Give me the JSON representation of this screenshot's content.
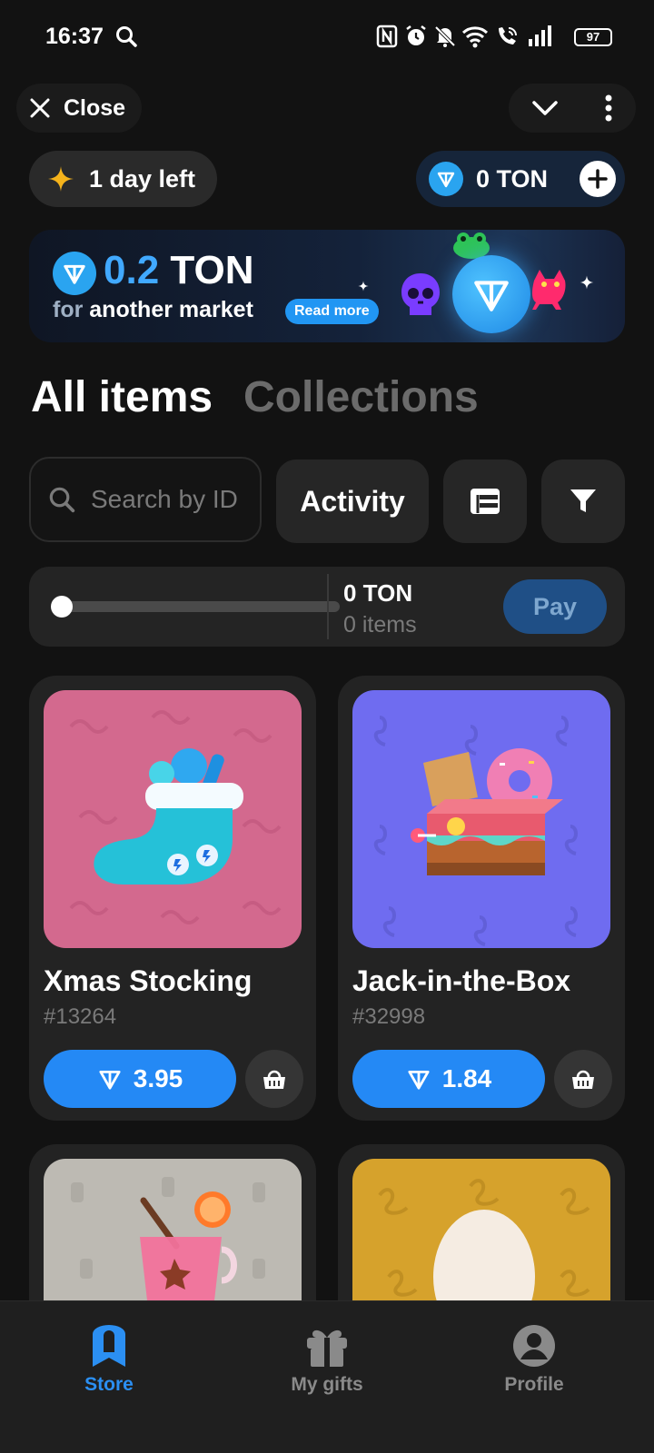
{
  "status_bar": {
    "time": "16:37",
    "battery": "97"
  },
  "header": {
    "close_label": "Close"
  },
  "badges": {
    "days_left": "1 day left",
    "balance": "0 TON"
  },
  "banner": {
    "amount_highlight": "0.2",
    "amount_unit": "TON",
    "sub_prefix": "for",
    "sub_text": "another market",
    "read_more": "Read more"
  },
  "tabs": {
    "active": "All items",
    "inactive": "Collections"
  },
  "toolbar": {
    "search_placeholder": "Search by ID",
    "activity_label": "Activity"
  },
  "selection": {
    "total": "0 TON",
    "count": "0 items",
    "pay_label": "Pay",
    "slider_level": 0
  },
  "items": [
    {
      "name": "Xmas Stocking",
      "number": "#13264",
      "price": "3.95"
    },
    {
      "name": "Jack-in-the-Box",
      "number": "#32998",
      "price": "1.84"
    }
  ],
  "nav": [
    {
      "label": "Store",
      "icon": "store-icon",
      "active": true
    },
    {
      "label": "My gifts",
      "icon": "gift-icon",
      "active": false
    },
    {
      "label": "Profile",
      "icon": "profile-icon",
      "active": false
    }
  ],
  "colors": {
    "accent": "#2489f5",
    "card_pink": "#d3698e",
    "card_purple": "#6f6cf0",
    "card_grey": "#bdbab3",
    "card_gold": "#d6a22c"
  }
}
